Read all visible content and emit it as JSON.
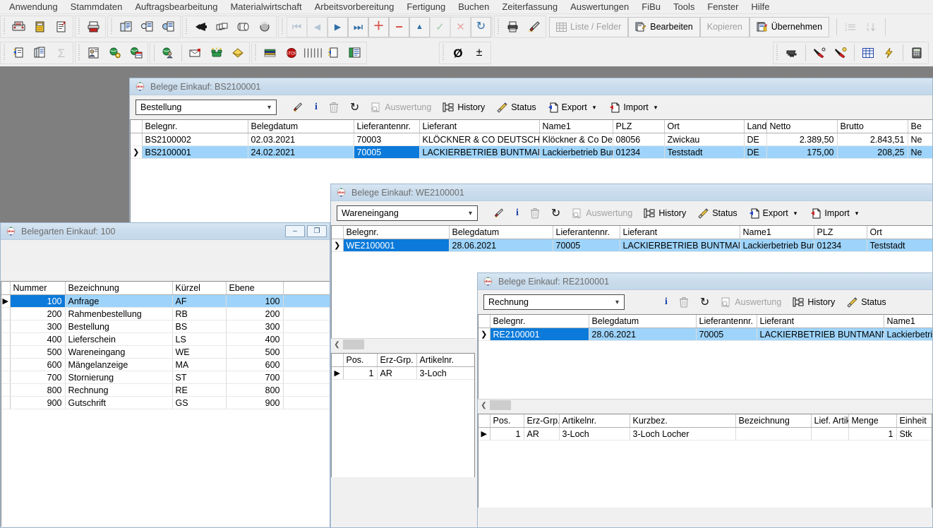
{
  "menubar": {
    "items": [
      {
        "label": "Anwendung"
      },
      {
        "label": "Stammdaten"
      },
      {
        "label": "Auftragsbearbeitung"
      },
      {
        "label": "Materialwirtschaft"
      },
      {
        "label": "Arbeitsvorbereitung"
      },
      {
        "label": "Fertigung"
      },
      {
        "label": "Buchen"
      },
      {
        "label": "Zeiterfassung"
      },
      {
        "label": "Auswertungen"
      },
      {
        "label": "FiBu"
      },
      {
        "label": "Tools"
      },
      {
        "label": "Fenster"
      },
      {
        "label": "Hilfe"
      }
    ]
  },
  "toolbar_row1": {
    "group1": [
      {
        "icon": "fax-machine-icon"
      },
      {
        "icon": "archive-box-icon"
      },
      {
        "icon": "document-pin-icon"
      }
    ],
    "group2": [
      {
        "icon": "printer-icon"
      }
    ],
    "group3": [
      {
        "icon": "document-copy-icon"
      },
      {
        "icon": "document-search-icon"
      },
      {
        "icon": "document-globe-icon"
      }
    ],
    "group4": [
      {
        "icon": "drill-icon"
      },
      {
        "icon": "boxes-icon"
      },
      {
        "icon": "roll-icon"
      },
      {
        "icon": "sphere-icon"
      }
    ],
    "nav": [
      {
        "icon": "first-record-icon",
        "glyph": "⏮",
        "disabled": true
      },
      {
        "icon": "prev-record-icon",
        "glyph": "◀",
        "disabled": true
      },
      {
        "icon": "next-record-icon",
        "glyph": "▶",
        "disabled": false
      },
      {
        "icon": "last-record-icon",
        "glyph": "⏭",
        "disabled": false
      },
      {
        "icon": "add-record-icon",
        "glyph": "＋",
        "disabled": false
      },
      {
        "icon": "delete-record-icon",
        "glyph": "−",
        "disabled": false
      },
      {
        "icon": "edit-record-icon",
        "glyph": "▲",
        "disabled": false
      },
      {
        "icon": "confirm-icon",
        "glyph": "✓",
        "disabled": true
      },
      {
        "icon": "cancel-icon",
        "glyph": "✕",
        "disabled": true
      },
      {
        "icon": "refresh-icon",
        "glyph": "↻",
        "disabled": false
      }
    ],
    "print_group": [
      {
        "icon": "print-icon"
      },
      {
        "icon": "highlighter-icon"
      }
    ],
    "buttons": [
      {
        "label": "Liste / Felder",
        "icon": "table-icon",
        "disabled": true
      },
      {
        "label": "Bearbeiten",
        "icon": "edit-pencil-icon",
        "disabled": false
      },
      {
        "label": "Kopieren",
        "icon": "copy-icon",
        "disabled": true
      },
      {
        "label": "Übernehmen",
        "icon": "apply-icon",
        "disabled": false
      }
    ],
    "sort_group": [
      {
        "icon": "numbered-list-icon",
        "disabled": true
      },
      {
        "icon": "sort-ascending-icon",
        "disabled": true
      }
    ]
  },
  "toolbar_row2": {
    "group1": [
      {
        "icon": "new-document-icon"
      },
      {
        "icon": "duplicate-document-icon"
      },
      {
        "icon": "sum-sigma-icon",
        "disabled": true
      }
    ],
    "group2": [
      {
        "icon": "report-person-icon"
      },
      {
        "icon": "globe-gear-icon"
      },
      {
        "icon": "globe-calendar-icon"
      }
    ],
    "group3": [
      {
        "icon": "globe-person-icon"
      }
    ],
    "group4": [
      {
        "icon": "envelope-icon"
      },
      {
        "icon": "phone-icon"
      },
      {
        "icon": "notebook-icon"
      }
    ],
    "group5": [
      {
        "icon": "layers-icon"
      },
      {
        "icon": "stop-sign-icon"
      },
      {
        "icon": "bars-icon"
      },
      {
        "icon": "new-doc-star-icon"
      },
      {
        "icon": "list-doc-icon"
      }
    ],
    "group6": [
      {
        "icon": "diameter-icon",
        "glyph": "Ø"
      },
      {
        "icon": "plus-minus-icon",
        "glyph": "±"
      }
    ],
    "group7": [
      {
        "icon": "anvil-icon"
      },
      {
        "icon": "tool-red-icon"
      },
      {
        "icon": "tool-yellow-icon"
      },
      {
        "icon": "grid-blue-icon"
      },
      {
        "icon": "lightning-icon"
      },
      {
        "icon": "calculator-icon"
      }
    ]
  },
  "window_bs": {
    "title": "Belege Einkauf: BS2100001",
    "app_icon": "abas-app-icon",
    "toolbar": {
      "combo_value": "Bestellung",
      "items": [
        {
          "label": "",
          "icon": "highlighter-icon",
          "disabled": false
        },
        {
          "label": "",
          "icon": "info-icon",
          "disabled": false
        },
        {
          "label": "",
          "icon": "trash-icon",
          "disabled": true
        },
        {
          "label": "",
          "icon": "refresh-icon",
          "disabled": false
        },
        {
          "label": "Auswertung",
          "icon": "evaluation-icon",
          "disabled": true
        },
        {
          "label": "History",
          "icon": "history-icon",
          "disabled": false
        },
        {
          "label": "Status",
          "icon": "status-brush-icon",
          "disabled": false
        },
        {
          "label": "Export",
          "icon": "export-icon",
          "disabled": false,
          "dropdown": true
        },
        {
          "label": "Import",
          "icon": "import-icon",
          "disabled": false,
          "dropdown": true
        }
      ]
    },
    "grid": {
      "columns": [
        "Belegnr.",
        "Belegdatum",
        "Lieferantennr.",
        "Lieferant",
        "Name1",
        "PLZ",
        "Ort",
        "Land",
        "Netto",
        "Brutto",
        "Be"
      ],
      "rows": [
        {
          "selected": false,
          "marker": "",
          "cells": [
            "BS2100002",
            "02.03.2021",
            "70003",
            "KLÖCKNER & CO DEUTSCHLAND GMB",
            "Klöckner & Co Deuts",
            "08056",
            "Zwickau",
            "DE",
            "2.389,50",
            "2.843,51",
            "Ne"
          ]
        },
        {
          "selected": true,
          "marker": "❯",
          "selected_cell": 2,
          "cells": [
            "BS2100001",
            "24.02.2021",
            "70005",
            "LACKIERBETRIEB BUNTMANN",
            "Lackierbetrieb Buntm",
            "01234",
            "Teststadt",
            "DE",
            "175,00",
            "208,25",
            "Ne"
          ]
        }
      ]
    }
  },
  "window_belegarten": {
    "title": "Belegarten Einkauf: 100",
    "app_icon": "abas-app-icon",
    "minimize_label": "–",
    "restore_label": "❐",
    "grid": {
      "columns": [
        "Nummer",
        "Bezeichnung",
        "Kürzel",
        "Ebene"
      ],
      "rows": [
        {
          "selected": true,
          "marker": "▶",
          "selected_cell": 0,
          "cells": [
            "100",
            "Anfrage",
            "AF",
            "100"
          ]
        },
        {
          "selected": false,
          "marker": "",
          "cells": [
            "200",
            "Rahmenbestellung",
            "RB",
            "200"
          ]
        },
        {
          "selected": false,
          "marker": "",
          "cells": [
            "300",
            "Bestellung",
            "BS",
            "300"
          ]
        },
        {
          "selected": false,
          "marker": "",
          "cells": [
            "400",
            "Lieferschein",
            "LS",
            "400"
          ]
        },
        {
          "selected": false,
          "marker": "",
          "cells": [
            "500",
            "Wareneingang",
            "WE",
            "500"
          ]
        },
        {
          "selected": false,
          "marker": "",
          "cells": [
            "600",
            "Mängelanzeige",
            "MA",
            "600"
          ]
        },
        {
          "selected": false,
          "marker": "",
          "cells": [
            "700",
            "Stornierung",
            "ST",
            "700"
          ]
        },
        {
          "selected": false,
          "marker": "",
          "cells": [
            "800",
            "Rechnung",
            "RE",
            "800"
          ]
        },
        {
          "selected": false,
          "marker": "",
          "cells": [
            "900",
            "Gutschrift",
            "GS",
            "900"
          ]
        }
      ]
    }
  },
  "window_we": {
    "title": "Belege Einkauf: WE2100001",
    "app_icon": "abas-app-icon",
    "toolbar": {
      "combo_value": "Wareneingang",
      "items": [
        {
          "label": "",
          "icon": "highlighter-icon",
          "disabled": false
        },
        {
          "label": "",
          "icon": "info-icon",
          "disabled": false
        },
        {
          "label": "",
          "icon": "trash-icon",
          "disabled": true
        },
        {
          "label": "",
          "icon": "refresh-icon",
          "disabled": false
        },
        {
          "label": "Auswertung",
          "icon": "evaluation-icon",
          "disabled": true
        },
        {
          "label": "History",
          "icon": "history-icon",
          "disabled": false
        },
        {
          "label": "Status",
          "icon": "status-brush-icon",
          "disabled": false
        },
        {
          "label": "Export",
          "icon": "export-icon",
          "disabled": false,
          "dropdown": true
        },
        {
          "label": "Import",
          "icon": "import-icon",
          "disabled": false,
          "dropdown": true
        }
      ]
    },
    "grid": {
      "columns": [
        "Belegnr.",
        "Belegdatum",
        "Lieferantennr.",
        "Lieferant",
        "Name1",
        "PLZ",
        "Ort"
      ],
      "rows": [
        {
          "selected": true,
          "marker": "❯",
          "selected_cell": 0,
          "cells": [
            "WE2100001",
            "28.06.2021",
            "70005",
            "LACKIERBETRIEB BUNTMANN",
            "Lackierbetrieb Buntm",
            "01234",
            "Teststadt"
          ]
        }
      ]
    },
    "positions_grid": {
      "columns": [
        "Pos.",
        "Erz-Grp.",
        "Artikelnr."
      ],
      "rows": [
        {
          "marker": "▶",
          "cells": [
            "1",
            "AR",
            "3-Loch"
          ]
        }
      ]
    }
  },
  "window_re": {
    "title": "Belege Einkauf: RE2100001",
    "app_icon": "abas-app-icon",
    "toolbar": {
      "combo_value": "Rechnung",
      "items": [
        {
          "label": "",
          "icon": "info-icon",
          "disabled": false
        },
        {
          "label": "",
          "icon": "trash-icon",
          "disabled": true
        },
        {
          "label": "",
          "icon": "refresh-icon",
          "disabled": false
        },
        {
          "label": "Auswertung",
          "icon": "evaluation-icon",
          "disabled": true
        },
        {
          "label": "History",
          "icon": "history-icon",
          "disabled": false
        },
        {
          "label": "Status",
          "icon": "status-brush-icon",
          "disabled": false
        }
      ]
    },
    "grid": {
      "columns": [
        "Belegnr.",
        "Belegdatum",
        "Lieferantennr.",
        "Lieferant",
        "Name1"
      ],
      "rows": [
        {
          "selected": true,
          "marker": "❯",
          "selected_cell": 0,
          "cells": [
            "RE2100001",
            "28.06.2021",
            "70005",
            "LACKIERBETRIEB BUNTMANN",
            "Lackierbetrieb"
          ]
        }
      ]
    },
    "positions_grid": {
      "columns": [
        "Pos.",
        "Erz-Grp.",
        "Artikelnr.",
        "Kurzbez.",
        "Bezeichnung",
        "Lief. Artikelnr.",
        "Menge",
        "Einheit"
      ],
      "rows": [
        {
          "marker": "▶",
          "cells": [
            "1",
            "AR",
            "3-Loch",
            "3-Loch Locher",
            "",
            "",
            "1",
            "Stk"
          ]
        }
      ]
    }
  },
  "colors": {
    "selection_blue": "#0b7ada",
    "row_highlight": "#9ed4fb",
    "desktop": "#807f7f",
    "titlebar": "#cadcec",
    "chrome": "#f0f0f0"
  }
}
